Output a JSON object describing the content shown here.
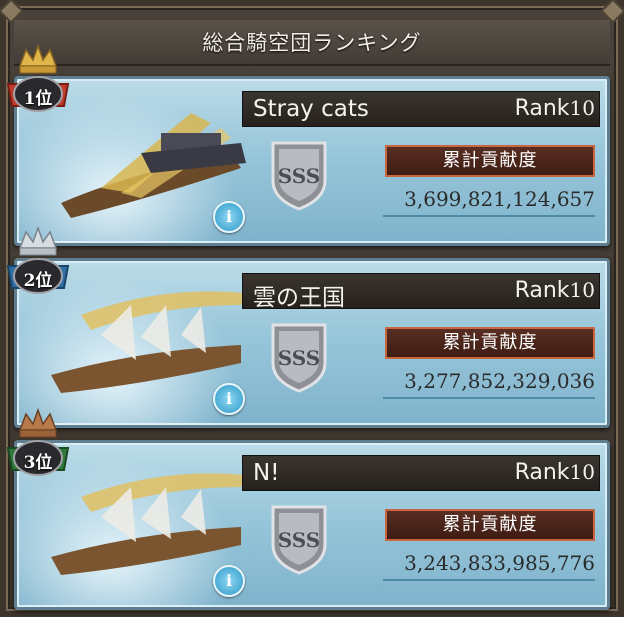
{
  "title": "総合騎空団ランキング",
  "colors": {
    "gold_medal": "#c23a2a",
    "silver_medal": "#2e6fa6",
    "bronze_medal": "#2f7a3a",
    "contrib_border": "#c9663f"
  },
  "entries": [
    {
      "rank_label": "1位",
      "name": "Stray cats",
      "rank_text": "Rank",
      "rank_num": "10",
      "badge": "SSS",
      "contrib_label": "累計貢献度",
      "contrib_value": "3,699,821,124,657",
      "info": "i"
    },
    {
      "rank_label": "2位",
      "name": "雲の王国",
      "rank_text": "Rank",
      "rank_num": "10",
      "badge": "SSS",
      "contrib_label": "累計貢献度",
      "contrib_value": "3,277,852,329,036",
      "info": "i"
    },
    {
      "rank_label": "3位",
      "name": "N!",
      "rank_text": "Rank",
      "rank_num": "10",
      "badge": "SSS",
      "contrib_label": "累計貢献度",
      "contrib_value": "3,243,833,985,776",
      "info": "i"
    }
  ]
}
